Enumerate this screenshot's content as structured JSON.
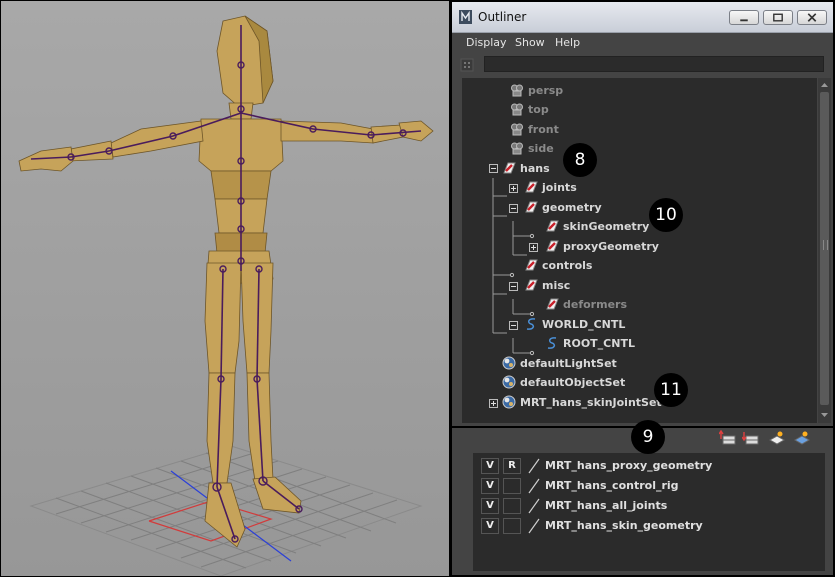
{
  "window": {
    "title": "Outliner"
  },
  "menu": [
    "Display",
    "Show",
    "Help"
  ],
  "filter": {
    "value": ""
  },
  "tree": [
    {
      "label": "persp",
      "icon": "camera-icon",
      "dim": true
    },
    {
      "label": "top",
      "icon": "camera-icon",
      "dim": true
    },
    {
      "label": "front",
      "icon": "camera-icon",
      "dim": true
    },
    {
      "label": "side",
      "icon": "camera-icon",
      "dim": true
    },
    {
      "label": "hans",
      "icon": "group-icon",
      "dim": false,
      "expander": "minus"
    },
    {
      "label": "joints",
      "icon": "group-icon",
      "dim": false,
      "expander": "plus"
    },
    {
      "label": "geometry",
      "icon": "group-icon",
      "dim": false,
      "expander": "minus"
    },
    {
      "label": "skinGeometry",
      "icon": "group-icon",
      "dim": false
    },
    {
      "label": "proxyGeometry",
      "icon": "group-icon",
      "dim": false,
      "expander": "plus"
    },
    {
      "label": "controls",
      "icon": "group-icon",
      "dim": false
    },
    {
      "label": "misc",
      "icon": "group-icon",
      "dim": false,
      "expander": "minus"
    },
    {
      "label": "deformers",
      "icon": "group-icon",
      "dim": true
    },
    {
      "label": "WORLD_CNTL",
      "icon": "curve-icon",
      "dim": false,
      "expander": "minus"
    },
    {
      "label": "ROOT_CNTL",
      "icon": "curve-icon",
      "dim": false
    },
    {
      "label": "defaultLightSet",
      "icon": "set-icon",
      "dim": false
    },
    {
      "label": "defaultObjectSet",
      "icon": "set-icon",
      "dim": false
    },
    {
      "label": "MRT_hans_skinJointSet",
      "icon": "set-icon",
      "dim": false,
      "expander": "plus"
    }
  ],
  "layers": [
    {
      "v": "V",
      "r": "R",
      "name": "MRT_hans_proxy_geometry"
    },
    {
      "v": "V",
      "r": "",
      "name": "MRT_hans_control_rig"
    },
    {
      "v": "V",
      "r": "",
      "name": "MRT_hans_all_joints"
    },
    {
      "v": "V",
      "r": "",
      "name": "MRT_hans_skin_geometry"
    }
  ],
  "layer_tools": [
    "move-layer-up-icon",
    "move-layer-down-icon",
    "new-layer-icon",
    "new-layer-from-selected-icon"
  ],
  "callouts": {
    "c8": "8",
    "c9": "9",
    "c10": "10",
    "c11": "11"
  },
  "colors": {
    "group_red": "#c8202a",
    "set_blue": "#3b6aa5",
    "curve_blue": "#4a8fd6",
    "body": "#c6a35a",
    "joint": "#4a1c5c"
  }
}
